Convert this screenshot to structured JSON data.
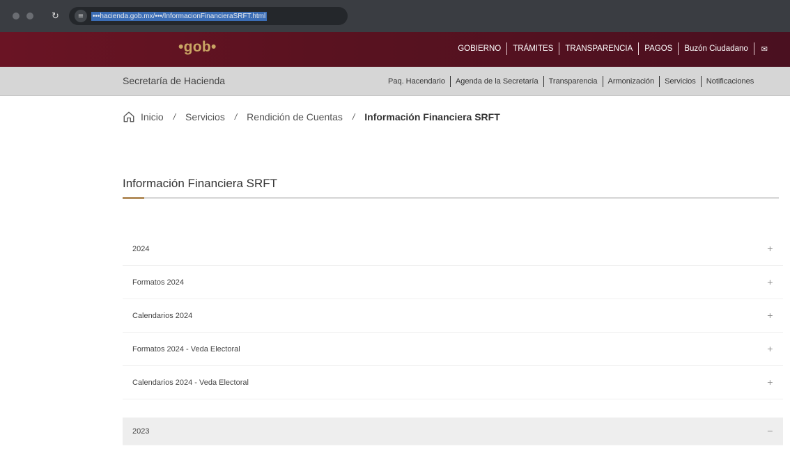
{
  "browser": {
    "url": "•••hacienda.gob.mx/•••/InformacionFinancieraSRFT.html",
    "reload_glyph": "↻",
    "site_info_glyph": "≡"
  },
  "gob_header": {
    "logo": "•gob•",
    "nav": [
      "GOBIERNO",
      "TRÁMITES",
      "TRANSPARENCIA",
      "PAGOS",
      "Buzón Ciudadano"
    ],
    "mail_glyph": "✉"
  },
  "secretaria": {
    "title": "Secretaría de Hacienda",
    "nav": [
      "Paq. Hacendario",
      "Agenda de la Secretaría",
      "Transparencia",
      "Armonización",
      "Servicios",
      "Notificaciones"
    ]
  },
  "breadcrumb": {
    "sep": "/",
    "items": [
      "Inicio",
      "Servicios",
      "Rendición de Cuentas"
    ],
    "current": "Información Financiera SRFT"
  },
  "page": {
    "title": "Información Financiera SRFT"
  },
  "accordion": {
    "plus": "+",
    "minus": "−",
    "items": [
      {
        "label": "2024"
      },
      {
        "label": "Formatos 2024"
      },
      {
        "label": "Calendarios 2024"
      },
      {
        "label": "Formatos 2024 - Veda Electoral"
      },
      {
        "label": "Calendarios 2024 - Veda Electoral"
      }
    ],
    "open_item": {
      "label": "2023"
    }
  },
  "colors": {
    "gob_brand": "#5c1320",
    "gob_gold": "#c9a564",
    "accent_gold": "#b38e5d"
  }
}
